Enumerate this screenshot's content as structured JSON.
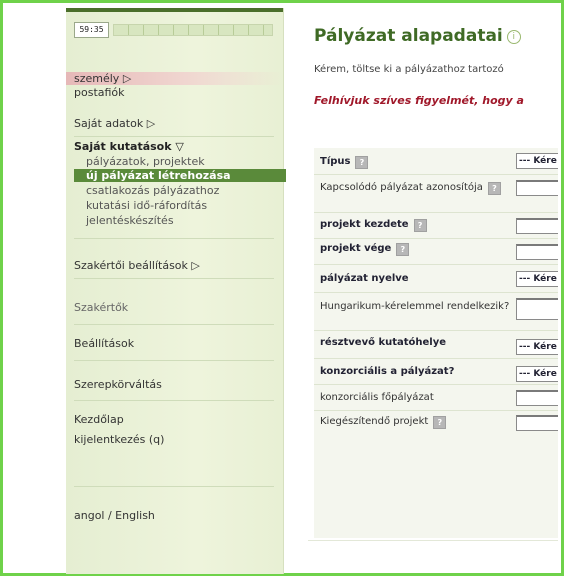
{
  "timer": {
    "value": "59:35"
  },
  "sidebar": {
    "szemely": "személy ▷",
    "postafiok": "postafiók",
    "sajat_adatok": "Saját adatok ▷",
    "sajat_kutatasok": "Saját kutatások ▽",
    "sub_items": [
      "pályázatok, projektek",
      "új pályázat létrehozása",
      "csatlakozás pályázathoz",
      "kutatási idő-ráfordítás",
      "jelentéskészítés"
    ],
    "szakertoi": "Szakértői beállítások ▷",
    "szakertok": "Szakértők",
    "beallitasok": "Beállítások",
    "szerepkorvaltas": "Szerepkörváltás",
    "kezdolap": "Kezdőlap",
    "kijelentkezes": "kijelentkezés (q)",
    "language": "angol / English"
  },
  "main": {
    "title": "Pályázat alapadatai",
    "intro": "Kérem, töltse ki a pályázathoz tartozó",
    "warning": "Felhívjuk szíves figyelmét, hogy a",
    "select_placeholder": "--- Kére"
  },
  "form": {
    "rows": [
      {
        "label": "Típus",
        "bold": true,
        "help": true,
        "control": "select"
      },
      {
        "label": "Kapcsolódó pályázat azonosítója",
        "bold": false,
        "help": true,
        "control": "input"
      },
      {
        "label": "projekt kezdete",
        "bold": true,
        "help": true,
        "control": "input"
      },
      {
        "label": "projekt vége",
        "bold": true,
        "help": true,
        "control": "input"
      },
      {
        "label": "pályázat nyelve",
        "bold": true,
        "help": false,
        "control": "select"
      },
      {
        "label": "Hungarikum-kérelemmel rendelkezik?",
        "bold": false,
        "help": false,
        "control": "input"
      },
      {
        "label": "résztvevő kutatóhelye",
        "bold": true,
        "help": false,
        "control": "select"
      },
      {
        "label": "konzorciális a pályázat?",
        "bold": true,
        "help": false,
        "control": "select"
      },
      {
        "label": "konzorciális főpályázat",
        "bold": false,
        "help": false,
        "control": "input"
      },
      {
        "label": "Kiegészítendő projekt",
        "bold": false,
        "help": true,
        "control": "input"
      }
    ]
  },
  "colors": {
    "frame": "#6fd24a",
    "title": "#3f6a25",
    "warning": "#a0182a",
    "active_nav": "#5a8a3a"
  },
  "icons": {
    "help": "question-mark-icon",
    "info": "info-icon"
  }
}
